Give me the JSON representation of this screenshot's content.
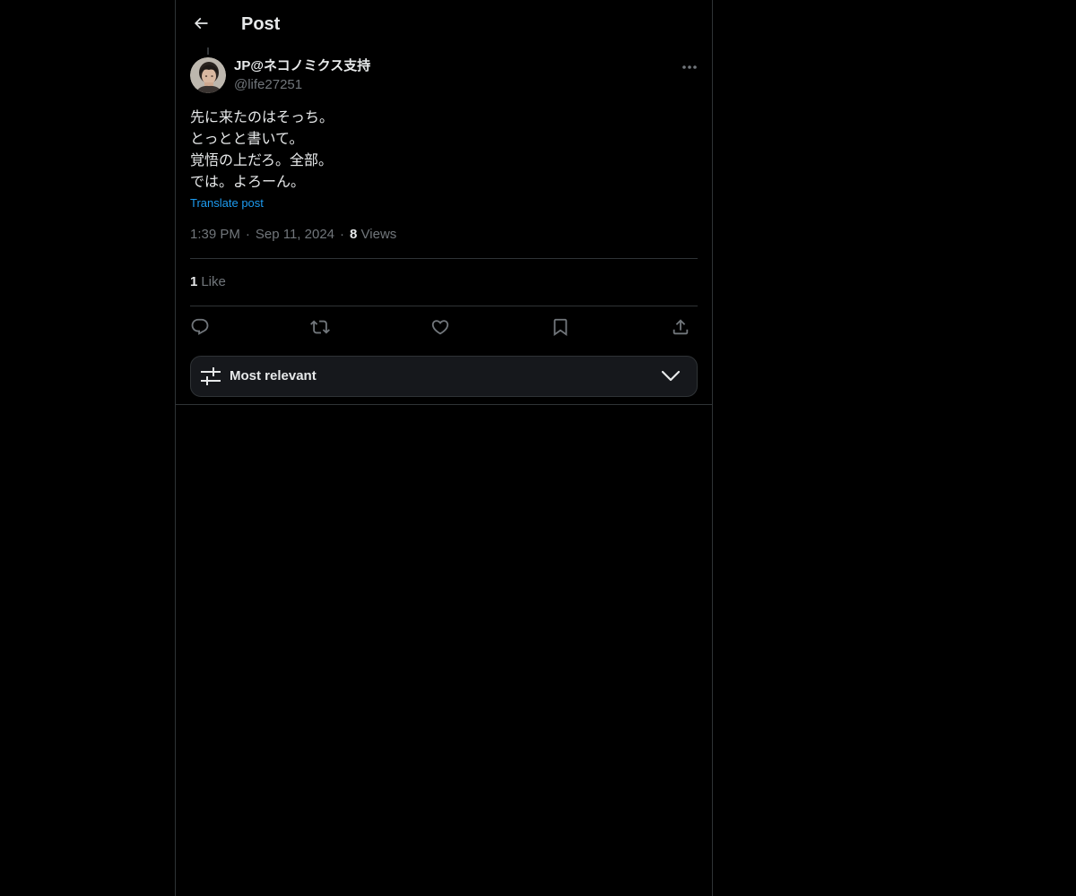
{
  "header": {
    "title": "Post",
    "back_icon": "arrow-left-icon"
  },
  "author": {
    "display_name": "JP@ネコノミクス支持",
    "handle": "@life27251"
  },
  "post": {
    "lines": [
      "先に来たのはそっち。",
      "とっとと書いて。",
      "覚悟の上だろ。全部。",
      "では。よろーん。"
    ],
    "translate_label": "Translate post",
    "time": "1:39 PM",
    "date": "Sep 11, 2024",
    "views_count": "8",
    "views_label": "Views",
    "likes_count": "1",
    "likes_label": "Like"
  },
  "actions": {
    "icons": [
      "reply-icon",
      "repost-icon",
      "like-icon",
      "bookmark-icon",
      "share-icon"
    ]
  },
  "sort": {
    "label": "Most relevant"
  },
  "colors": {
    "background": "#000000",
    "text": "#e7e9ea",
    "secondary": "#71767b",
    "link": "#1d9bf0",
    "border": "#2f3336"
  }
}
